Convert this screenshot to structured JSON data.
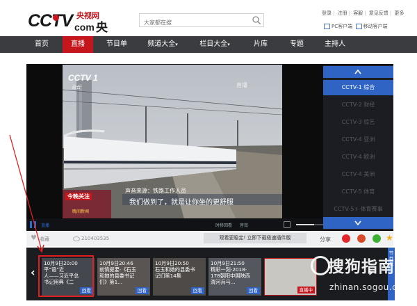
{
  "header": {
    "logo_brand": "CCTV",
    "logo_domain": "com",
    "logo_cn_small": "央视网",
    "logo_cn": "央视",
    "search_placeholder": "大家都在搜",
    "top_links": [
      "登录",
      "注册",
      "客服",
      "意见反馈",
      "更多"
    ],
    "pc_client": "PC客户端",
    "mobile_client": "移动客户端"
  },
  "nav": {
    "items": [
      "首页",
      "直播",
      "节目单",
      "频道大全",
      "栏目大全",
      "片库",
      "专题",
      "主持人"
    ],
    "active_index": 1
  },
  "player": {
    "channel_logo": "CCTV 1",
    "channel_sub": "综合",
    "overlay_tag": "直播",
    "news_tag": "今晚关注",
    "news_sub": "晚间新闻",
    "source_caption": "声音来源：铁路工作人员",
    "subtitle": "我们做到了，就是让你坐的更舒服",
    "live_label": "直播",
    "controls_text_1": "时移回看",
    "controls_text_2": "音效"
  },
  "channels": {
    "items": [
      "CCTV-1 综合",
      "CCTV-2 财经",
      "CCTV-3 综艺",
      "CCTV-4 亚洲",
      "CCTV-4 欧洲",
      "CCTV-4 美洲",
      "CCTV-5 体育",
      "CCTV-5+ 体育赛事"
    ],
    "active_index": 0
  },
  "infobar": {
    "likes": "收藏",
    "views": "210403535",
    "download_text": "观看更稳定! 立即下载极速插件版",
    "share_label": "分享"
  },
  "schedule": {
    "programs": [
      {
        "text": "10月9日20:00\n平“语”近\n人——习近平总\n书记用典《二",
        "badge": "回看"
      },
      {
        "text": "10月9日20:46\n前情提要-《石玉\n和她的县委书记\n们》第1...",
        "badge": "回看"
      },
      {
        "text": "10月9日20:50\n石玉和她的县委书\n记们第14集",
        "badge": "回看"
      },
      {
        "text": "10月9日21:50\n精彩一刻-2018-\n178朝阳中国陕西\n渭河兵马...",
        "badge": "回看"
      },
      {
        "text": "",
        "badge": "直播中"
      }
    ],
    "side_label": "节目单",
    "watermark_brand": "搜狗指南",
    "watermark_url": "zhinan.sogou.com"
  },
  "colors": {
    "nav_bg": "#3a3c40",
    "accent_red": "#c4161c",
    "accent_blue": "#2f64c4",
    "annotation_red": "#e02020"
  }
}
